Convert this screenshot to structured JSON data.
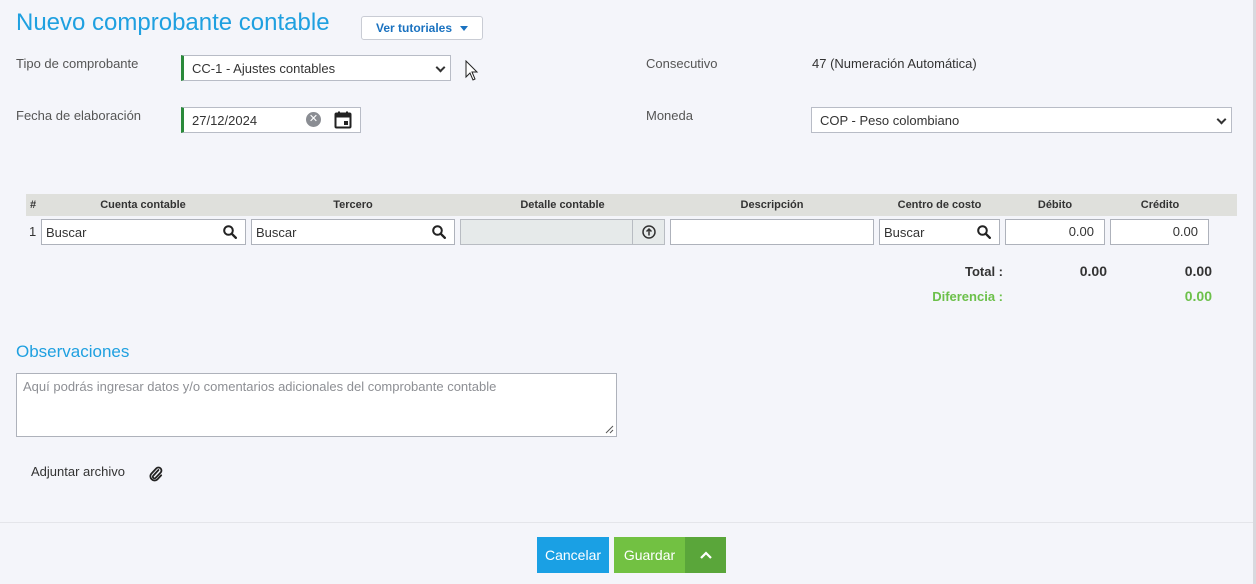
{
  "header": {
    "title": "Nuevo comprobante contable",
    "tutorials_label": "Ver tutoriales"
  },
  "form": {
    "voucher_type_label": "Tipo de comprobante",
    "voucher_type_value": "CC-1 - Ajustes contables",
    "date_label": "Fecha de elaboración",
    "date_value": "27/12/2024",
    "consecutive_label": "Consecutivo",
    "consecutive_value": "47 (Numeración Automática)",
    "currency_label": "Moneda",
    "currency_value": "COP - Peso colombiano"
  },
  "table": {
    "headers": [
      "#",
      "Cuenta contable",
      "Tercero",
      "Detalle contable",
      "Descripción",
      "Centro de costo",
      "Débito",
      "Crédito"
    ],
    "rows": [
      {
        "num": "1",
        "account": "Buscar",
        "third_party": "Buscar",
        "detail": "",
        "description": "",
        "cost_center": "Buscar",
        "debit": "0.00",
        "credit": "0.00"
      }
    ]
  },
  "totals": {
    "total_label": "Total :",
    "total_debit": "0.00",
    "total_credit": "0.00",
    "difference_label": "Diferencia :",
    "difference_value": "0.00"
  },
  "observations": {
    "title": "Observaciones",
    "placeholder": "Aquí podrás ingresar datos y/o comentarios adicionales del comprobante contable"
  },
  "attachment": {
    "label": "Adjuntar archivo"
  },
  "footer": {
    "cancel_label": "Cancelar",
    "save_label": "Guardar"
  },
  "colors": {
    "accent_blue": "#1fa0e0",
    "save_green": "#72c142",
    "difference_green": "#6cc04a"
  }
}
